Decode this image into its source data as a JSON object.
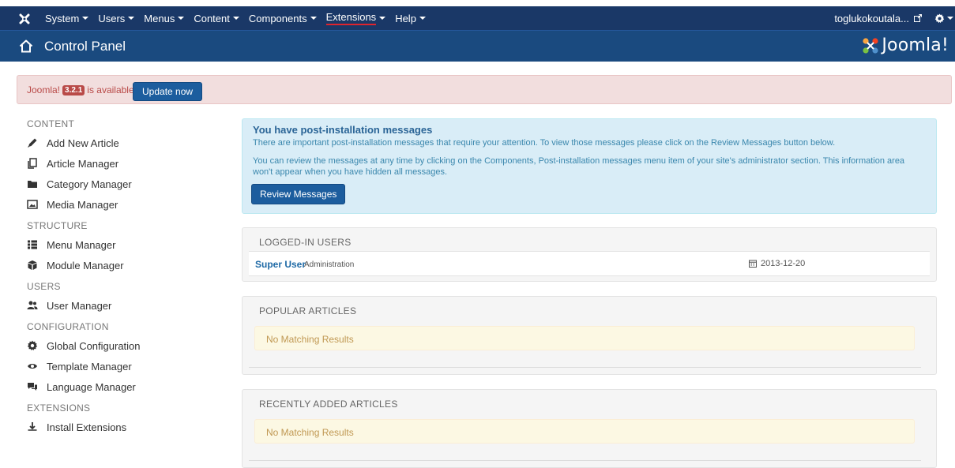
{
  "navbar": {
    "menus": [
      {
        "label": "System"
      },
      {
        "label": "Users"
      },
      {
        "label": "Menus"
      },
      {
        "label": "Content"
      },
      {
        "label": "Components"
      },
      {
        "label": "Extensions"
      },
      {
        "label": "Help"
      }
    ],
    "user_link": "toglukokoutala...",
    "bg_color": "#1a3867"
  },
  "header": {
    "title": "Control Panel",
    "logo_text": "Joomla!",
    "bg_color": "#1a4a7f"
  },
  "update_alert": {
    "prefix": "Joomla!",
    "version": "3.2.1",
    "suffix": "is available:",
    "button": "Update now"
  },
  "sidebar": {
    "sections": [
      {
        "title": "CONTENT",
        "items": [
          {
            "label": "Add New Article",
            "icon": "pencil-icon"
          },
          {
            "label": "Article Manager",
            "icon": "copy-icon"
          },
          {
            "label": "Category Manager",
            "icon": "folder-icon"
          },
          {
            "label": "Media Manager",
            "icon": "image-icon"
          }
        ]
      },
      {
        "title": "STRUCTURE",
        "items": [
          {
            "label": "Menu Manager",
            "icon": "list-icon"
          },
          {
            "label": "Module Manager",
            "icon": "cube-icon"
          }
        ]
      },
      {
        "title": "USERS",
        "items": [
          {
            "label": "User Manager",
            "icon": "users-icon"
          }
        ]
      },
      {
        "title": "CONFIGURATION",
        "items": [
          {
            "label": "Global Configuration",
            "icon": "cog-icon"
          },
          {
            "label": "Template Manager",
            "icon": "eye-icon"
          },
          {
            "label": "Language Manager",
            "icon": "comments-icon"
          }
        ]
      },
      {
        "title": "EXTENSIONS",
        "items": [
          {
            "label": "Install Extensions",
            "icon": "download-icon"
          }
        ]
      }
    ]
  },
  "post_install": {
    "heading": "You have post-installation messages",
    "text1": "There are important post-installation messages that require your attention. To view those messages please click on the Review Messages button below.",
    "text2": "You can review the messages at any time by clicking on the Components, Post-installation messages menu item of your site's administrator section. This information area won't appear when you have hidden all messages.",
    "button": "Review Messages"
  },
  "logged_in": {
    "title": "LOGGED-IN USERS",
    "users": [
      {
        "name": "Super User",
        "role": "Administration",
        "date": "2013-12-20"
      }
    ]
  },
  "popular": {
    "title": "POPULAR ARTICLES",
    "empty": "No Matching Results"
  },
  "recent": {
    "title": "RECENTLY ADDED ARTICLES",
    "empty": "No Matching Results"
  }
}
